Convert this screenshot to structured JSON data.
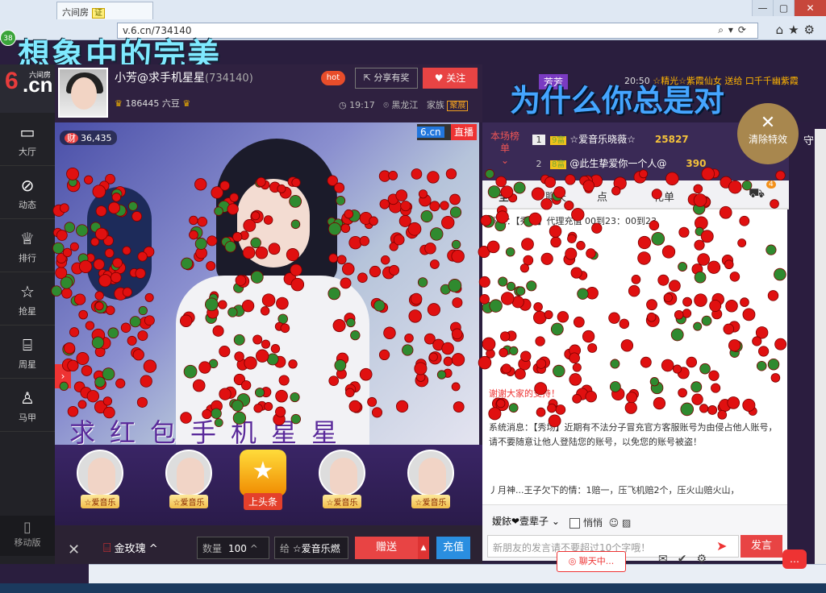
{
  "browser": {
    "tab_title": "六间房",
    "tab_cert": "证",
    "address": "v.6.cn/734140",
    "window_buttons": [
      "—",
      "▢",
      "✕"
    ]
  },
  "overlay_text_top": "想象中的完美",
  "overlay_text_right": "为什么你总是对",
  "badge_count": "38",
  "sidebar": {
    "logo_six": "6",
    "logo_cn": ".cn",
    "logo_sub": "六间房",
    "items": [
      {
        "label": "大厅",
        "icon": "tv-icon"
      },
      {
        "label": "动态",
        "icon": "compass-icon"
      },
      {
        "label": "排行",
        "icon": "crown-icon"
      },
      {
        "label": "抢星",
        "icon": "star-icon"
      },
      {
        "label": "周星",
        "icon": "gift-icon"
      },
      {
        "label": "马甲",
        "icon": "shirt-icon"
      }
    ],
    "mobile_label": "移动版"
  },
  "host": {
    "name": "小芳@求手机星星",
    "room_id": "(734140)",
    "beans": "186445 六豆",
    "hot_label": "hot",
    "share_label": "分享有奖",
    "follow_label": "关注",
    "time": "19:17",
    "location": "黑龙江",
    "family_label": "家族",
    "family_badge": "聚展"
  },
  "video": {
    "viewers": "36,435",
    "brand": "6.cn",
    "live_label": "直播",
    "caption": "求红包手机星星"
  },
  "gifts": [
    {
      "label": "☆爱音乐"
    },
    {
      "label": "☆爱音乐"
    },
    {
      "label": "上头条"
    },
    {
      "label": "☆爱音乐"
    },
    {
      "label": "☆爱音乐"
    }
  ],
  "controls": {
    "gift_name": "金玫瑰",
    "qty_label": "数量",
    "qty_value": "100",
    "to_label": "给",
    "to_value": "☆爱音乐燃",
    "send_label": "赠送",
    "recharge_label": "充值"
  },
  "rank": {
    "title": "本场榜单",
    "xiusheng": "芳芳",
    "time": "20:50",
    "ticker": "☆精光☆紫霞仙女 送给 口千千幽紫霞",
    "rows": [
      {
        "n": "1",
        "level": "9富",
        "name": "☆爱音乐晓薇☆",
        "points": "25827"
      },
      {
        "n": "2",
        "level": "8富",
        "name": "@此生挚爱你一个人@",
        "points": "390"
      }
    ],
    "clear_effects": "清除特效",
    "guard_label": "守"
  },
  "chat": {
    "tabs": [
      "全",
      "聊天",
      "点",
      "礼单"
    ],
    "car_count": "4",
    "messages": [
      {
        "text": "系统：【秀场】代理充值 00到23：00到23",
        "highlight": "代理充值"
      },
      {
        "text": "谢谢大家的支持！",
        "highlight": ""
      },
      {
        "text": "系统消息：【秀场】近期有不法分子冒充官方客服账号为由侵占他人账号，请不要随意让他人登陆您的账号，以免您的账号被盗！",
        "highlight": "【秀场】"
      },
      {
        "text": "丿月神...王子欠下的情：1赔一，压飞机赔2个，压火山赔火山，",
        "highlight": ""
      }
    ],
    "to_user": "嫒銥❤壹辈子",
    "whisper_label": "悄悄",
    "input_placeholder": "新朋友的发言请不要超过10个字哦！",
    "send_label": "发言",
    "chatting_label": "聊天中..."
  }
}
